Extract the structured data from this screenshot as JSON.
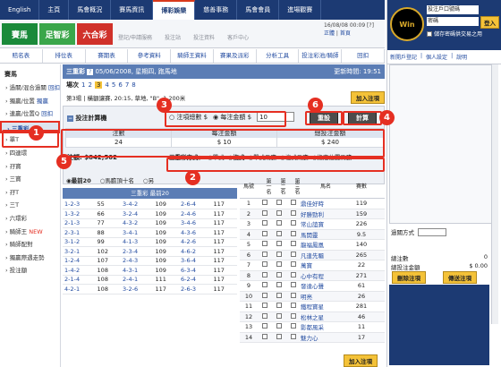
{
  "top_nav": [
    "English",
    "主頁",
    "馬會概況",
    "賽馬資訊",
    "博彩娛樂",
    "慈善事務",
    "馬會會員",
    "進場觀賽"
  ],
  "game_tabs": [
    {
      "label": "賽馬",
      "color": "#1a8a3a"
    },
    {
      "label": "足智彩",
      "color": "#2c9a3a"
    },
    {
      "label": "六合彩",
      "color": "#d0312a"
    }
  ],
  "sub_links": [
    "登記/申請服務",
    "投注站",
    "投注資料",
    "客戶中心"
  ],
  "date_line": "16/08/08 00:09 [?]",
  "date_line2": "正體",
  "date_line3": "首頁",
  "tabs": [
    "賠名表",
    "排位表",
    "賽期表",
    "參考資料",
    "騎師王資料",
    "賽果及派彩",
    "分析工具",
    "投注彩池/騎師",
    "回扣"
  ],
  "left_nav": {
    "heading": "賽馬",
    "items": [
      {
        "label": "過關/混合過關",
        "extra": "回扣"
      },
      {
        "label": "獨贏/位置",
        "extra": "獨贏"
      },
      {
        "label": "連贏/位置Q",
        "extra": "回扣"
      },
      {
        "label": "三重彩",
        "extra": ""
      },
      {
        "label": "單T",
        "extra": ""
      },
      {
        "label": "四連環",
        "extra": ""
      },
      {
        "label": "孖寶",
        "extra": ""
      },
      {
        "label": "三寶",
        "extra": ""
      },
      {
        "label": "孖T",
        "extra": ""
      },
      {
        "label": "三T",
        "extra": ""
      },
      {
        "label": "六環彩",
        "extra": ""
      },
      {
        "label": "騎師王",
        "extra": "NEW"
      },
      {
        "label": "騎師配對",
        "extra": ""
      },
      {
        "label": "獨贏際遇走勢",
        "extra": ""
      },
      {
        "label": "投注額",
        "extra": ""
      }
    ]
  },
  "main": {
    "race_title": "三重彩",
    "race_info": "05/06/2008, 星期四, 跑馬地",
    "update": "更新時間: 19:51",
    "race_select_label": "場次",
    "race_numbers": [
      "1",
      "2",
      "3",
      "4",
      "5",
      "6",
      "7",
      "8"
    ],
    "race_desc": "第3場  |  橫額讓賽, 20:15, 草地, \"B\", 1,200米",
    "add_bet": "加入注項",
    "calc_title": "投注計算機",
    "radio_units": "注項總數 $",
    "radio_amount": "每注金額 $",
    "amount_value": "10",
    "reset": "重設",
    "calc": "計算",
    "calc_headers": [
      "注數",
      "每注金額",
      "總投注金額"
    ],
    "calc_values": [
      "24",
      "$ 10",
      "$ 240"
    ],
    "pool_label": "注額: $842,502",
    "bet_type_label": "三重彩方式：",
    "bet_types": [
      "單式",
      "複式",
      "單式馬膽",
      "複式馬膽",
      "指定位置馬膽"
    ],
    "odds_tabs": [
      "最前20",
      "馬膽頂十名",
      "另"
    ],
    "odds_header": "三重彩 最前20",
    "odds_rows": [
      [
        "1-2-3",
        "55",
        "3-4-2",
        "109",
        "2-6-4",
        "117"
      ],
      [
        "1-3-2",
        "66",
        "3-2-4",
        "109",
        "2-4-6",
        "117"
      ],
      [
        "2-1-3",
        "77",
        "4-3-2",
        "109",
        "3-4-6",
        "117"
      ],
      [
        "2-3-1",
        "88",
        "3-4-1",
        "109",
        "4-3-6",
        "117"
      ],
      [
        "3-1-2",
        "99",
        "4-1-3",
        "109",
        "4-2-6",
        "117"
      ],
      [
        "3-2-1",
        "102",
        "2-3-4",
        "109",
        "4-6-2",
        "117"
      ],
      [
        "1-2-4",
        "107",
        "2-4-3",
        "109",
        "3-6-4",
        "117"
      ],
      [
        "1-4-2",
        "108",
        "4-3-1",
        "109",
        "6-3-4",
        "117"
      ],
      [
        "2-1-4",
        "108",
        "2-4-1",
        "111",
        "6-2-4",
        "117"
      ],
      [
        "4-2-1",
        "108",
        "3-2-6",
        "117",
        "2-6-3",
        "117"
      ]
    ],
    "horse_headers": [
      "馬號",
      "第一名",
      "第二名",
      "第三名",
      "馬名",
      "賽數"
    ],
    "horses": [
      [
        "1",
        "鼎佳好時",
        "119"
      ],
      [
        "2",
        "好勝勁利",
        "159"
      ],
      [
        "3",
        "常山誼寶",
        "226"
      ],
      [
        "4",
        "馬開靈",
        "9.5"
      ],
      [
        "5",
        "龍福鳳凰",
        "140"
      ],
      [
        "6",
        "凡逢先驅",
        "265"
      ],
      [
        "7",
        "萬寶",
        "22"
      ],
      [
        "8",
        "心中有程",
        "271"
      ],
      [
        "9",
        "發達心聲",
        "61"
      ],
      [
        "10",
        "明亮",
        "26"
      ],
      [
        "11",
        "鐵程寶星",
        "281"
      ],
      [
        "12",
        "松林之星",
        "46"
      ],
      [
        "13",
        "影都風采",
        "11"
      ],
      [
        "14",
        "魅力心",
        "17"
      ]
    ]
  },
  "right_panel": {
    "login_label": "投注戶口號碼",
    "password_label": "密碼",
    "login_btn": "登入",
    "remember": "儲存密碼供交易之用",
    "tabs": [
      "新開戶登記",
      "個人設定",
      "說明"
    ],
    "method_label": "過關方式",
    "total_label": "總注數",
    "total_value": "0",
    "amount_label": "總投注金額",
    "amount_value": "$ 0.00",
    "delete_btn": "刪除注項",
    "send_btn": "傳送注項"
  },
  "annotations": [
    "1",
    "2",
    "3",
    "4",
    "5",
    "6"
  ],
  "colors": {
    "nav": "#1c3a73",
    "header": "#5b7db5",
    "red": "#e52f22",
    "gold": "#f4c238"
  }
}
